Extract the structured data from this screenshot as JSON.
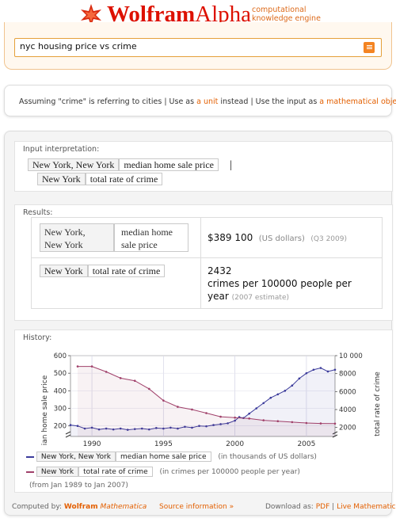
{
  "header": {
    "logo_wolfram": "Wolfram",
    "logo_alpha": "Alpha",
    "tagline_line1": "computational",
    "tagline_line2": "knowledge engine"
  },
  "search": {
    "query": "nyc housing price vs crime"
  },
  "assumption": {
    "prefix": "Assuming \"crime\" is referring to cities",
    "sep1": " | Use as ",
    "link1": "a unit",
    "mid": " instead",
    "sep2": " | Use the input as ",
    "link2": "a mathematical object"
  },
  "input_interpretation": {
    "title": "Input interpretation:",
    "row1_city": "New York, New York",
    "row1_prop": "median home sale price",
    "separator": "|",
    "row2_city": "New York",
    "row2_prop": "total rate of crime"
  },
  "results": {
    "title": "Results:",
    "row1_city_line1": "New York,",
    "row1_city_line2": "New York",
    "row1_prop_line1": "median home",
    "row1_prop_line2": "sale price",
    "row1_value": "$389 100",
    "row1_unit": "(US dollars)",
    "row1_period": "(Q3 2009)",
    "row2_city": "New York",
    "row2_prop": "total rate of crime",
    "row2_value": "2432",
    "row2_unit_line1": "crimes per 100000 people per",
    "row2_unit_line2": "year",
    "row2_note": "(2007 estimate)"
  },
  "history": {
    "title": "History:",
    "legend1_city": "New York, New York",
    "legend1_prop": "median home sale price",
    "legend1_unit": "(in thousands of US dollars)",
    "legend2_city": "New York",
    "legend2_prop": "total rate of crime",
    "legend2_unit": "(in crimes per 100000 people per year)",
    "range_note": "(from Jan 1989 to Jan 2007)",
    "colors": {
      "price": "#3b3b9b",
      "crime": "#a0406a"
    }
  },
  "chart_data": {
    "type": "line",
    "xlabel": "",
    "ylabel": "median home sale price",
    "y2label": "total rate of crime",
    "xlim": [
      1988.5,
      2007
    ],
    "ylim": [
      140,
      600
    ],
    "y2lim": [
      1000,
      10000
    ],
    "xticks": [
      "1990",
      "1995",
      "2000",
      "2005"
    ],
    "yticks": [
      "200",
      "300",
      "400",
      "500",
      "600"
    ],
    "y2ticks": [
      "2000",
      "4000",
      "6000",
      "8000",
      "10 000"
    ],
    "grid": true,
    "series": [
      {
        "name": "median home sale price",
        "axis": "left",
        "x": [
          1988.5,
          1989,
          1989.5,
          1990,
          1990.5,
          1991,
          1991.5,
          1992,
          1992.5,
          1993,
          1993.5,
          1994,
          1994.5,
          1995,
          1995.5,
          1996,
          1996.5,
          1997,
          1997.5,
          1998,
          1998.5,
          1999,
          1999.5,
          2000,
          2000.3,
          2000.6,
          2001,
          2001.5,
          2002,
          2002.5,
          2003,
          2003.5,
          2004,
          2004.5,
          2005,
          2005.5,
          2006,
          2006.5,
          2007
        ],
        "y": [
          205,
          200,
          185,
          190,
          180,
          185,
          180,
          185,
          178,
          182,
          185,
          180,
          188,
          185,
          190,
          185,
          195,
          190,
          200,
          198,
          205,
          210,
          215,
          230,
          250,
          245,
          270,
          300,
          330,
          360,
          380,
          400,
          430,
          470,
          500,
          520,
          530,
          510,
          520
        ]
      },
      {
        "name": "total rate of crime",
        "axis": "right",
        "x": [
          1989,
          1990,
          1991,
          1992,
          1993,
          1994,
          1995,
          1996,
          1997,
          1998,
          1999,
          2000,
          2001,
          2002,
          2003,
          2004,
          2005,
          2006,
          2007
        ],
        "y": [
          8800,
          8800,
          8200,
          7500,
          7200,
          6300,
          5000,
          4300,
          4000,
          3600,
          3200,
          3100,
          3000,
          2800,
          2700,
          2600,
          2500,
          2450,
          2432
        ]
      }
    ]
  },
  "footer": {
    "computed_by": "Computed by:",
    "wolfram": "Wolfram",
    "mathematica": "Mathematica",
    "source_info": "Source information »",
    "download_as": "Download as:",
    "pdf": "PDF",
    "live": "Live Mathematica",
    "sep": "|"
  }
}
